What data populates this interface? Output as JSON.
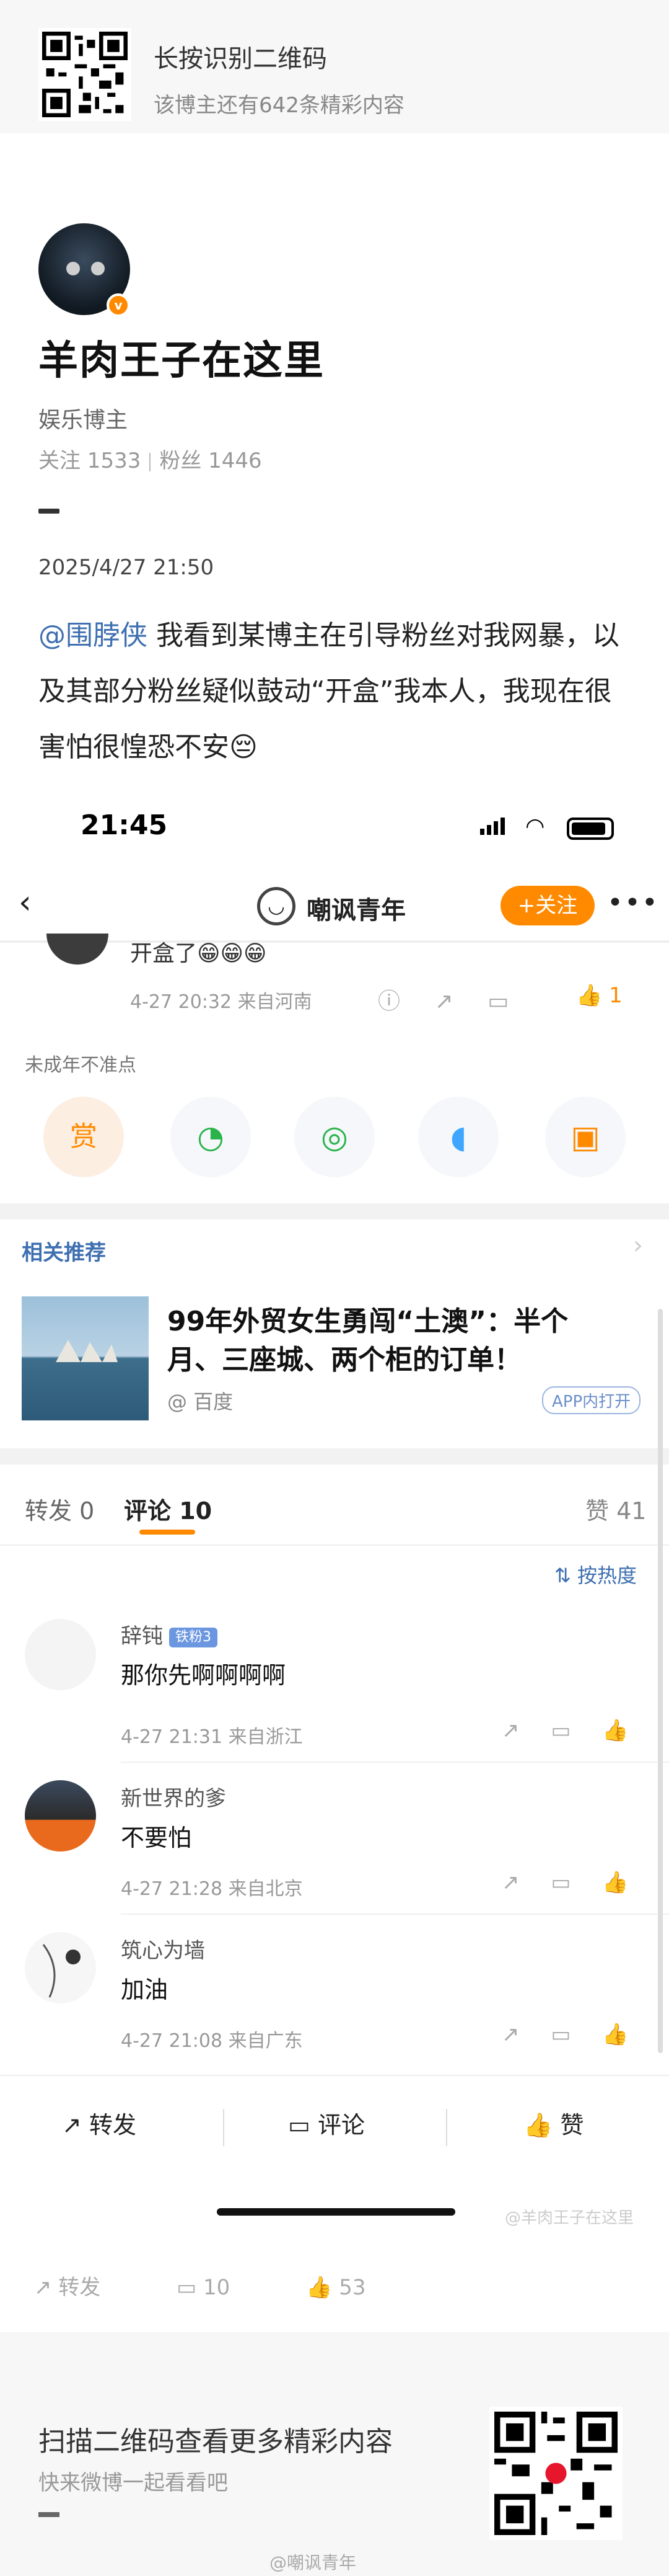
{
  "top": {
    "title": "长按识别二维码",
    "subtitle": "该博主还有642条精彩内容"
  },
  "profile": {
    "name": "羊肉王子在这里",
    "role": "娱乐博主",
    "following_label": "关注 1533",
    "followers_label": "粉丝 1446",
    "date": "2025/4/27 21:50"
  },
  "post": {
    "mention": "@围脖侠",
    "text": " 我看到某博主在引导粉丝对我网暴，以及其部分粉丝疑似鼓动“开盒”我本人，我现在很害怕很惶恐不安😔"
  },
  "embedded": {
    "status_time": "21:45",
    "nav_title": "嘲讽青年",
    "follow_label": "+关注",
    "top_comment_text": "开盒了😁😁😁",
    "top_comment_meta": "4-27 20:32  来自河南",
    "top_comment_likes": "1",
    "minor_notice": "未成年不准点",
    "reward_label": "赏",
    "related_title": "相关推荐",
    "related_text": "99年外贸女生勇闯“土澳”：半个月、三座城、两个柜的订单！",
    "related_source": "@ 百度",
    "related_app": "APP内打开",
    "tab_forward": "转发 0",
    "tab_comment": "评论 10",
    "tab_like": "赞 41",
    "sort_label": "按热度",
    "comments": [
      {
        "name": "辞钝",
        "badge": "铁粉3",
        "text": "那你先啊啊啊啊",
        "meta": "4-27 21:31  来自浙江"
      },
      {
        "name": "新世界的爹",
        "badge": "",
        "text": "不要怕",
        "meta": "4-27 21:28  来自北京"
      },
      {
        "name": "筑心为墙",
        "badge": "",
        "text": "加油",
        "meta": "4-27 21:08  来自广东"
      }
    ],
    "action_forward": "转发",
    "action_comment": "评论",
    "action_like": "赞",
    "watermark": "@羊肉王子在这里"
  },
  "post_actions": {
    "forward": "转发",
    "comments": "10",
    "likes": "53"
  },
  "footer": {
    "title": "扫描二维码查看更多精彩内容",
    "subtitle": "快来微博一起看看吧",
    "watermark": "@嘲讽青年"
  }
}
